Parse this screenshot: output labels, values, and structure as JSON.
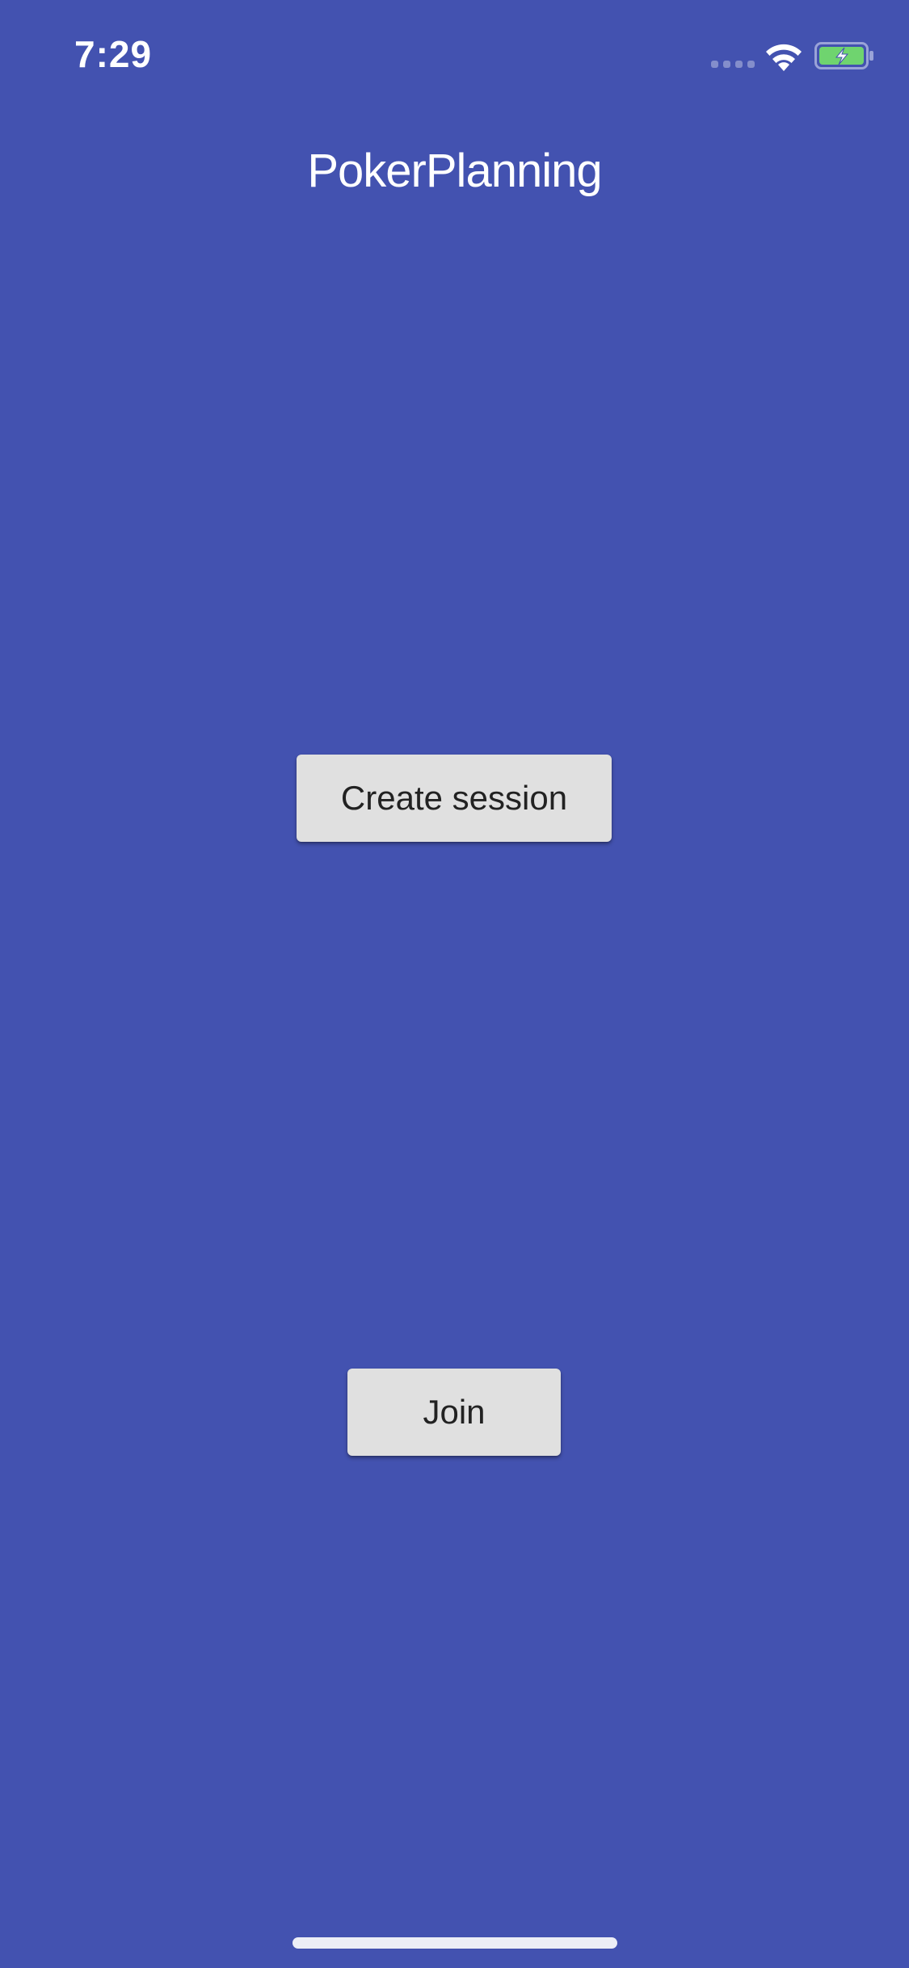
{
  "status_bar": {
    "time": "7:29",
    "icons": [
      "signal-dots-icon",
      "wifi-icon",
      "battery-charging-icon"
    ]
  },
  "app": {
    "title": "PokerPlanning"
  },
  "actions": {
    "create_label": "Create session",
    "join_label": "Join"
  },
  "colors": {
    "background": "#4352b0",
    "button_bg": "#e0e0e0",
    "button_text": "#222222",
    "battery_fill": "#6fd46f"
  }
}
